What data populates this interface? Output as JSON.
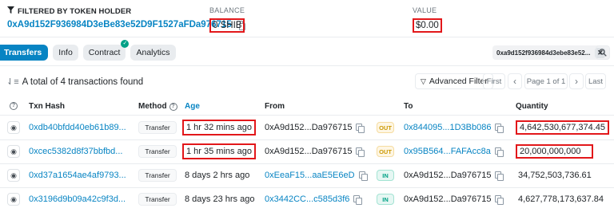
{
  "holder": {
    "title": "FILTERED BY TOKEN HOLDER",
    "address": "0xA9d152F936984D3eBe83e52D9F1527aFDa976715"
  },
  "balance": {
    "label": "BALANCE",
    "value": "0 SHIB"
  },
  "value": {
    "label": "VALUE",
    "value": "$0.00"
  },
  "tabs": [
    "Transfers",
    "Info",
    "Contract",
    "Analytics"
  ],
  "filter_pill": {
    "label": "0xa9d152f936984d3ebe83e52...",
    "close": "✕"
  },
  "summary": "A total of 4 transactions found",
  "advanced_filter": "Advanced Filter",
  "pager": {
    "first": "First",
    "prev": "‹",
    "info": "Page 1 of 1",
    "next": "›",
    "last": "Last"
  },
  "columns": [
    "Txn Hash",
    "Method",
    "Age",
    "From",
    "To",
    "Quantity"
  ],
  "rows": [
    {
      "hash": "0xdb40bfdd40eb61b89...",
      "method": "Transfer",
      "age": "1 hr 32 mins ago",
      "from": "0xA9d152...Da976715",
      "dir": "OUT",
      "to": "0x844095...1D3Bb086",
      "qty": "4,642,530,677,374.45"
    },
    {
      "hash": "0xcec5382d8f37bbfbd...",
      "method": "Transfer",
      "age": "1 hr 35 mins ago",
      "from": "0xA9d152...Da976715",
      "dir": "OUT",
      "to": "0x95B564...FAFAcc8a",
      "qty": "20,000,000,000"
    },
    {
      "hash": "0xd37a1654ae4af9793...",
      "method": "Transfer",
      "age": "8 days 2 hrs ago",
      "from": "0xEeaF15...aaE5E6eD",
      "dir": "IN",
      "to": "0xA9d152...Da976715",
      "qty": "34,752,503,736.61"
    },
    {
      "hash": "0x3196d9b09a42c9f3d...",
      "method": "Transfer",
      "age": "8 days 23 hrs ago",
      "from": "0x3442CC...c585d3f6",
      "dir": "IN",
      "to": "0xA9d152...Da976715",
      "qty": "4,627,778,173,637.84"
    }
  ],
  "colors": {
    "link": "#0784c3",
    "highlight": "#e2171a",
    "out": "#cc9a06",
    "in": "#00a186"
  }
}
